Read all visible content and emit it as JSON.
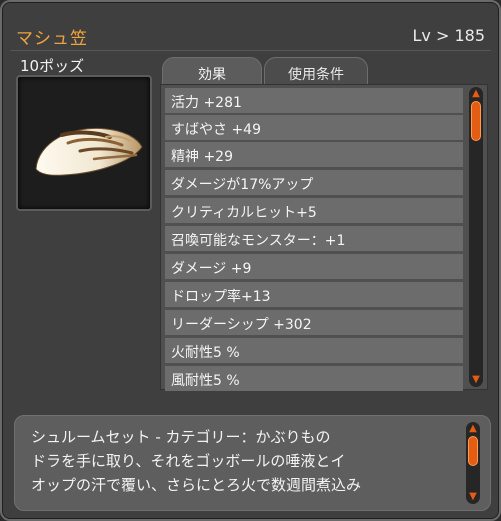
{
  "item": {
    "name": "マシュ笠",
    "level_text": "Lv > 185",
    "price": "10ポッズ",
    "icon": "mushroom-cap-icon"
  },
  "tabs": [
    {
      "label": "効果",
      "active": true
    },
    {
      "label": "使用条件",
      "active": false
    }
  ],
  "stats": [
    "活力 +281",
    "すばやさ +49",
    "精神 +29",
    "ダメージが17%アップ",
    "クリティカルヒット+5",
    "召喚可能なモンスター：+1",
    "ダメージ +9",
    "ドロップ率+13",
    "リーダーシップ +302",
    "火耐性5 %",
    "風耐性5 %"
  ],
  "description": [
    "シュルームセット - カテゴリー：かぶりもの",
    "ドラを手に取り、それをゴッボールの唾液とイ",
    "オップの汗で覆い、さらにとろ火で数週間煮込み"
  ],
  "colors": {
    "title": "#f0a33c",
    "accent": "#e45d12",
    "panel": "#3f3f3f",
    "row": "#6c6c6c"
  }
}
